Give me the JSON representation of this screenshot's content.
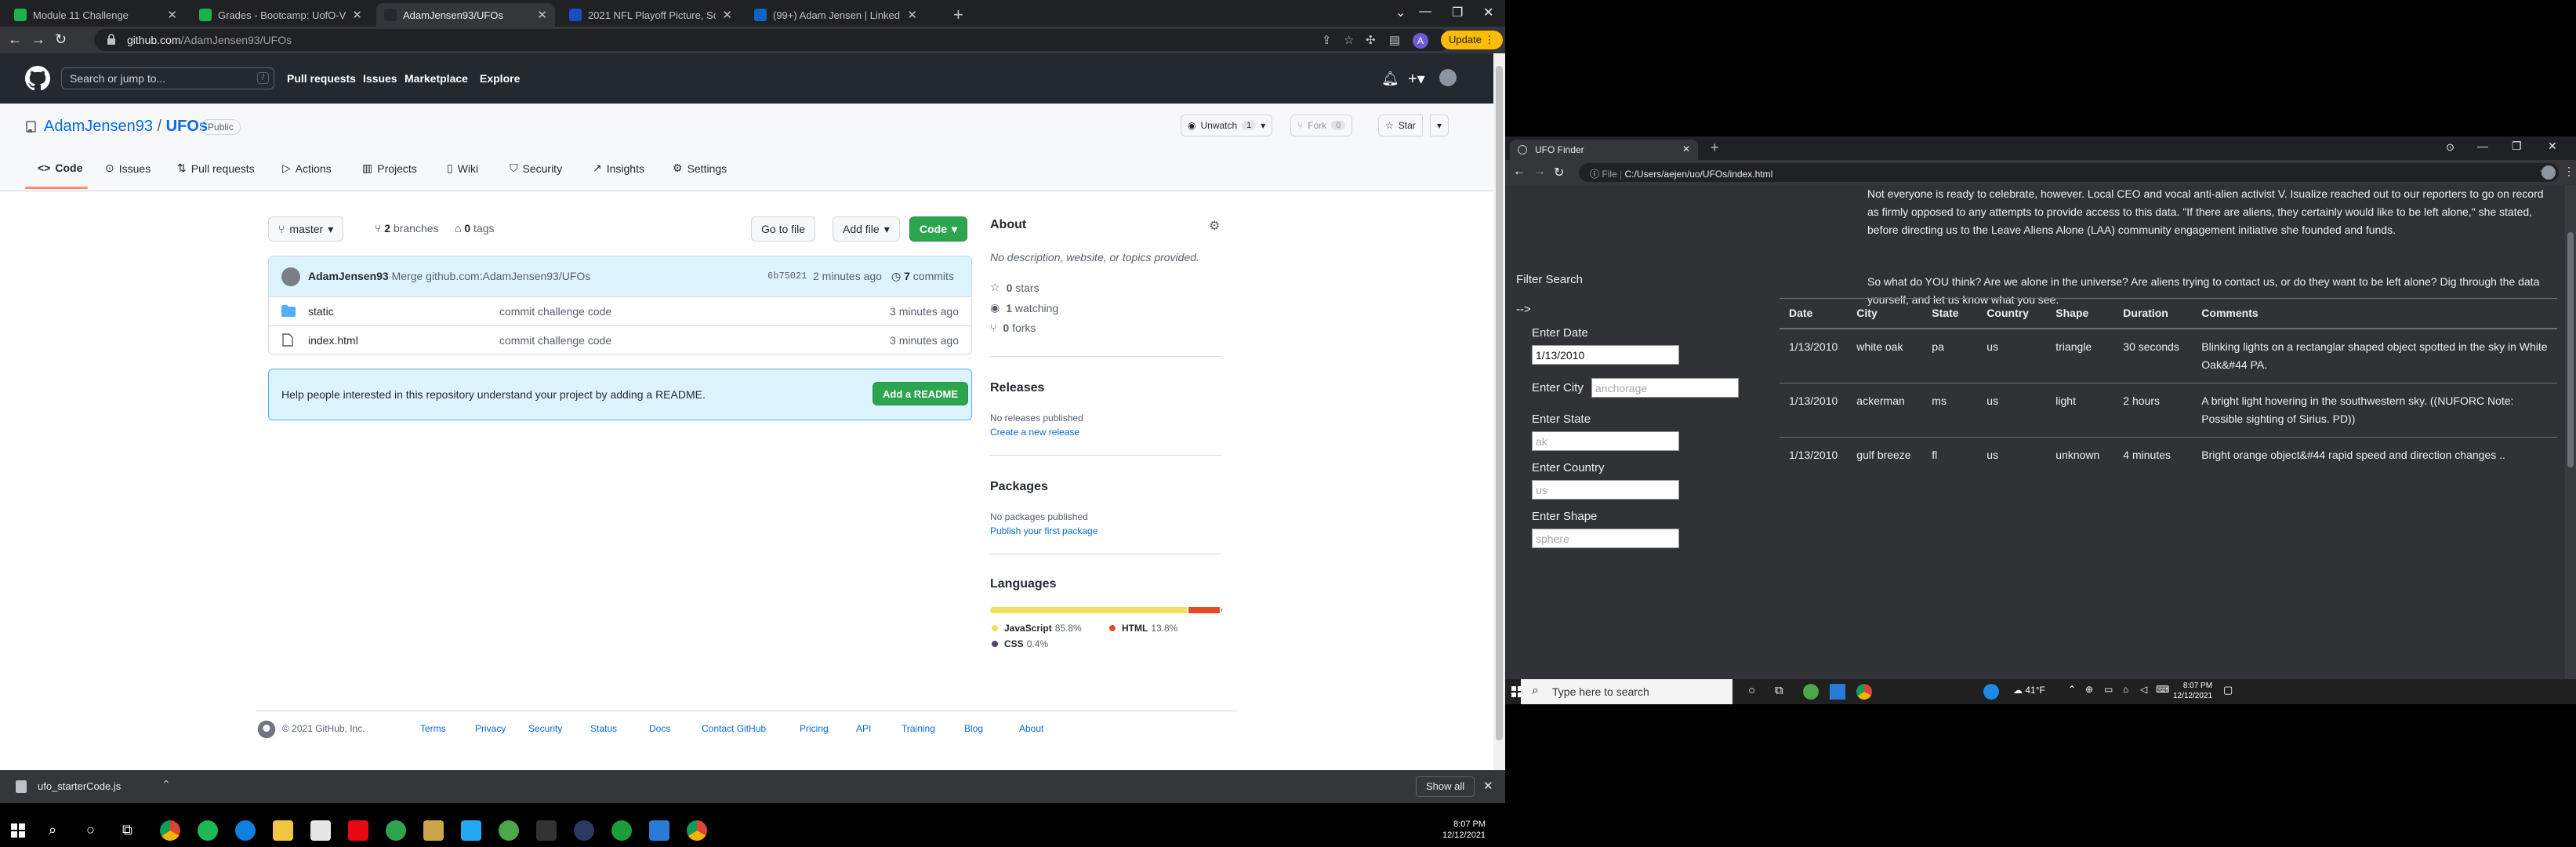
{
  "left_browser": {
    "tabs": [
      {
        "title": "Module 11 Challenge",
        "color": "#1bb24a"
      },
      {
        "title": "Grades - Bootcamp: UofO-VIRT-",
        "color": "#1bb24a"
      },
      {
        "title": "AdamJensen93/UFOs",
        "color": "#24292f"
      },
      {
        "title": "2021 NFL Playoff Picture, Scena",
        "color": "#1a4cc7"
      },
      {
        "title": "(99+) Adam Jensen | LinkedIn",
        "color": "#0a66c2"
      }
    ],
    "url_host": "github.com",
    "url_path": "/AdamJensen93/UFOs",
    "update_label": "Update",
    "profile_initial": "A"
  },
  "github": {
    "search_placeholder": "Search or jump to...",
    "search_key": "/",
    "nav": [
      "Pull requests",
      "Issues",
      "Marketplace",
      "Explore"
    ],
    "owner": "AdamJensen93",
    "separator": "/",
    "repo": "UFOs",
    "visibility": "Public",
    "unwatch_label": "Unwatch",
    "unwatch_count": "1",
    "fork_label": "Fork",
    "fork_count": "0",
    "star_label": "Star",
    "repo_tabs": [
      "Code",
      "Issues",
      "Pull requests",
      "Actions",
      "Projects",
      "Wiki",
      "Security",
      "Insights",
      "Settings"
    ],
    "branch": "master",
    "branches_count": "2",
    "branches_label": "branches",
    "tags_count": "0",
    "tags_label": "tags",
    "go_to_file": "Go to file",
    "add_file": "Add file",
    "code_btn": "Code",
    "commit_author": "AdamJensen93",
    "commit_message": "Merge github.com:AdamJensen93/UFOs",
    "commit_sha": "6b75021",
    "commit_time": "2 minutes ago",
    "commit_count": "7",
    "commits_label": "commits",
    "files": [
      {
        "name": "static",
        "type": "folder",
        "message": "commit challenge code",
        "time": "3 minutes ago"
      },
      {
        "name": "index.html",
        "type": "file",
        "message": "commit challenge code",
        "time": "3 minutes ago"
      }
    ],
    "readme_prompt": "Help people interested in this repository understand your project by adding a README.",
    "add_readme": "Add a README",
    "about_title": "About",
    "about_text": "No description, website, or topics provided.",
    "stars": "0",
    "stars_label": "stars",
    "watching": "1",
    "watching_label": "watching",
    "forks": "0",
    "forks_label": "forks",
    "releases_title": "Releases",
    "releases_text": "No releases published",
    "releases_link": "Create a new release",
    "packages_title": "Packages",
    "packages_text": "No packages published",
    "packages_link": "Publish your first package",
    "languages_title": "Languages",
    "languages": [
      {
        "name": "JavaScript",
        "pct": "85.8%",
        "value": 85.8,
        "color": "#f1e05a"
      },
      {
        "name": "HTML",
        "pct": "13.8%",
        "value": 13.8,
        "color": "#e34c26"
      },
      {
        "name": "CSS",
        "pct": "0.4%",
        "value": 0.4,
        "color": "#563d7c"
      }
    ],
    "footer_copyright": "© 2021 GitHub, Inc.",
    "footer_links": [
      "Terms",
      "Privacy",
      "Security",
      "Status",
      "Docs",
      "Contact GitHub",
      "Pricing",
      "API",
      "Training",
      "Blog",
      "About"
    ]
  },
  "downloads": {
    "file": "ufo_starterCode.js",
    "show_all": "Show all"
  },
  "left_taskbar": {
    "time": "8:07 PM",
    "date": "12/12/2021"
  },
  "right_browser": {
    "tab_title": "UFO Finder",
    "url_label": "File",
    "url": "C:/Users/aejen/uo/UFOs/index.html",
    "paragraph1": "Not everyone is ready to celebrate, however. Local CEO and vocal anti-alien activist V. Isualize reached out to our reporters to go on record as firmly opposed to any attempts to provide access to this data. \"If there are aliens, they certainly would like to be left alone,\" she stated, before directing us to the Leave Aliens Alone (LAA) community engagement initiative she founded and funds.",
    "paragraph2": "So what do YOU think? Are we alone in the universe? Are aliens trying to contact us, or do they want to be left alone? Dig through the data yourself, and let us know what you see.",
    "filter_title": "Filter Search",
    "stray_text": "-->",
    "filters": [
      {
        "label": "Enter Date",
        "value": "1/13/2010",
        "placeholder": ""
      },
      {
        "label": "Enter City",
        "value": "",
        "placeholder": "anchorage"
      },
      {
        "label": "Enter State",
        "value": "",
        "placeholder": "ak"
      },
      {
        "label": "Enter Country",
        "value": "",
        "placeholder": "us"
      },
      {
        "label": "Enter Shape",
        "value": "",
        "placeholder": "sphere"
      }
    ],
    "table_headers": [
      "Date",
      "City",
      "State",
      "Country",
      "Shape",
      "Duration",
      "Comments"
    ],
    "table_rows": [
      [
        "1/13/2010",
        "white oak",
        "pa",
        "us",
        "triangle",
        "30 seconds",
        "Blinking lights on a rectanglar shaped object spotted in the sky in White Oak&#44 PA."
      ],
      [
        "1/13/2010",
        "ackerman",
        "ms",
        "us",
        "light",
        "2 hours",
        "A bright light hovering in the southwestern sky. ((NUFORC Note: Possible sighting of Sirius. PD))"
      ],
      [
        "1/13/2010",
        "gulf breeze",
        "fl",
        "us",
        "unknown",
        "4 minutes",
        "Bright orange object&#44 rapid speed and direction changes .."
      ]
    ]
  },
  "right_taskbar": {
    "search_placeholder": "Type here to search",
    "weather": "41°F",
    "time": "8:07 PM",
    "date": "12/12/2021"
  }
}
